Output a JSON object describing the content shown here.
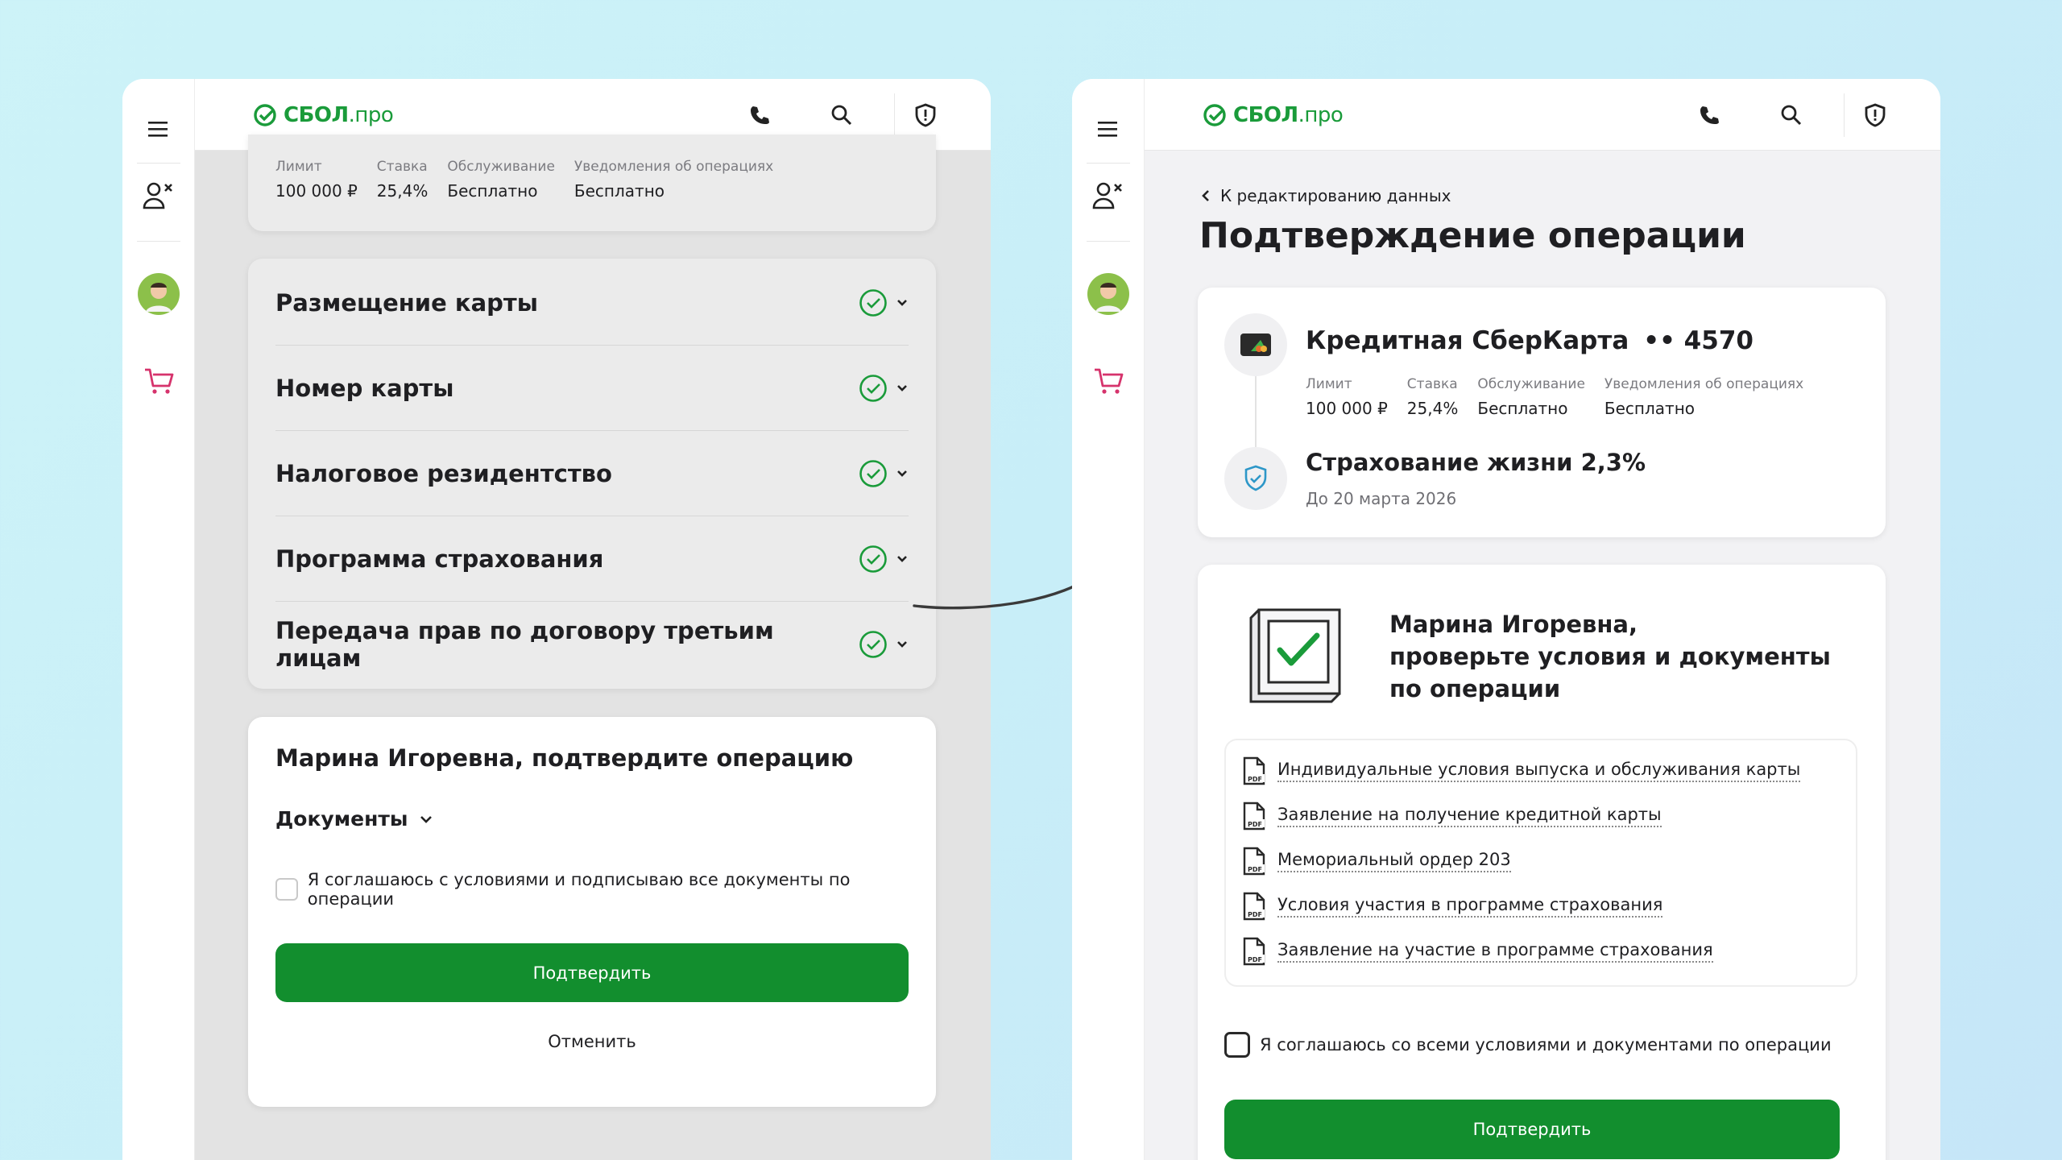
{
  "brand": {
    "name": "СБОЛ",
    "suffix": ".про",
    "color": "#1a9b3a"
  },
  "left": {
    "summary": {
      "columns": [
        {
          "label": "Лимит",
          "value": "100 000 ₽"
        },
        {
          "label": "Ставка",
          "value": "25,4%"
        },
        {
          "label": "Обслуживание",
          "value": "Бесплатно"
        },
        {
          "label": "Уведомления об операциях",
          "value": "Бесплатно"
        }
      ]
    },
    "sections": [
      "Размещение карты",
      "Номер карты",
      "Налоговое резидентство",
      "Программа страхования",
      "Передача прав по договору третьим лицам"
    ],
    "confirm": {
      "title": "Марина Игоревна, подтвердите операцию",
      "documents_label": "Документы",
      "agree_text": "Я соглашаюсь с условиями и подписываю все документы по операции",
      "confirm_button": "Подтвердить",
      "cancel_button": "Отменить"
    }
  },
  "right": {
    "back_link": "К редактированию данных",
    "page_title": "Подтверждение операции",
    "card": {
      "name": "Кредитная СберКарта",
      "masked_number": "•• 4570",
      "columns": [
        {
          "label": "Лимит",
          "value": "100 000 ₽"
        },
        {
          "label": "Ставка",
          "value": "25,4%"
        },
        {
          "label": "Обслуживание",
          "value": "Бесплатно"
        },
        {
          "label": "Уведомления об операциях",
          "value": "Бесплатно"
        }
      ]
    },
    "insurance": {
      "title": "Страхование жизни 2,3%",
      "until": "До 20 марта 2026"
    },
    "review": {
      "heading_line1": "Марина Игоревна,",
      "heading_line2": "проверьте условия и документы",
      "heading_line3": "по операции",
      "documents": [
        "Индивидуальные условия выпуска и обслуживания карты",
        "Заявление на получение кредитной карты",
        "Мемориальный ордер 203",
        "Условия участия в программе страхования",
        "Заявление на участие в программе страхования"
      ],
      "pdf_tag": "PDF",
      "agree_text": "Я соглашаюсь со всеми условиями и документами по операции",
      "confirm_button": "Подтвердить"
    }
  },
  "colors": {
    "primary_green": "#128e2e",
    "check_green": "#1a9b3a",
    "cart_pink": "#d6336c"
  }
}
